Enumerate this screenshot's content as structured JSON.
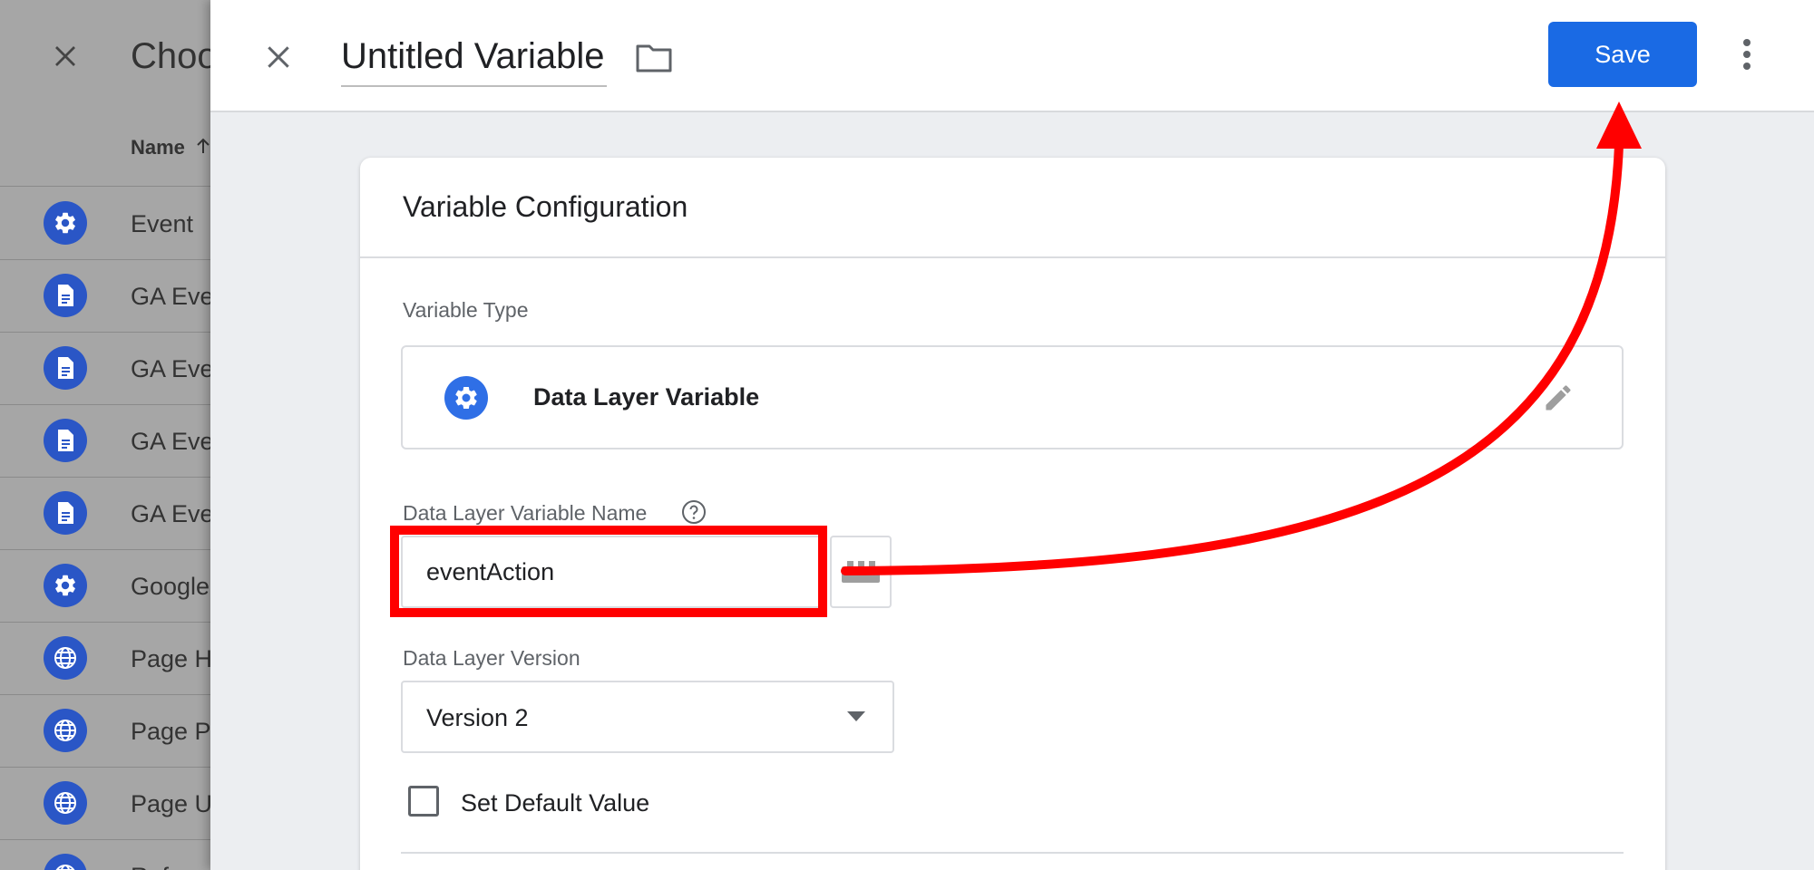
{
  "background": {
    "title": "Choo",
    "column_header": "Name",
    "rows": [
      {
        "label": "Event",
        "icon": "gear-icon"
      },
      {
        "label": "GA Eve",
        "icon": "document-icon"
      },
      {
        "label": "GA Eve",
        "icon": "document-icon"
      },
      {
        "label": "GA Eve",
        "icon": "document-icon"
      },
      {
        "label": "GA Eve",
        "icon": "document-icon"
      },
      {
        "label": "Google",
        "icon": "gear-icon"
      },
      {
        "label": "Page H",
        "icon": "globe-icon"
      },
      {
        "label": "Page P",
        "icon": "globe-icon"
      },
      {
        "label": "Page U",
        "icon": "globe-icon"
      },
      {
        "label": "Referre",
        "icon": "globe-icon"
      }
    ]
  },
  "header": {
    "title": "Untitled Variable",
    "save_label": "Save"
  },
  "card": {
    "title": "Variable Configuration",
    "variable_type_label": "Variable Type",
    "variable_type_name": "Data Layer Variable",
    "dl_name_label": "Data Layer Variable Name",
    "dl_name_value": "eventAction",
    "dl_version_label": "Data Layer Version",
    "dl_version_value": "Version 2",
    "default_value_label": "Set Default Value",
    "default_value_checked": false
  },
  "colors": {
    "accent": "#1a6ae4",
    "annotation": "#ff0000",
    "icon_blue": "#2f6fe6"
  }
}
